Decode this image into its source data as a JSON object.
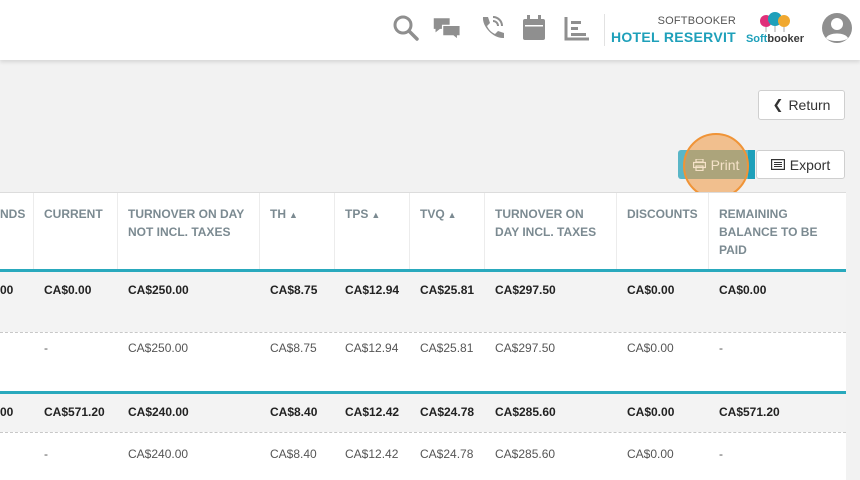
{
  "header": {
    "brand_small": "SOFTBOOKER",
    "brand_big": "HOTEL RESERVIT",
    "logo_text_a": "Soft",
    "logo_text_b": "booker",
    "icons": [
      "search-icon",
      "chat-icon",
      "phone-icon",
      "calendar-icon",
      "bar-chart-icon",
      "user-avatar-icon"
    ]
  },
  "actions": {
    "return_label": "Return",
    "print_label": "Print",
    "export_label": "Export"
  },
  "colors": {
    "accent": "#1ea0ba",
    "print_button": "#5ab6c7",
    "highlight": "#f09437",
    "header_text": "#7b8a91"
  },
  "table": {
    "headers": [
      {
        "line1": "NDS",
        "line2": "",
        "line3": ""
      },
      {
        "line1": "CURRENT",
        "line2": "",
        "line3": ""
      },
      {
        "line1": "TURNOVER ON DAY",
        "line2": "NOT INCL. TAXES",
        "line3": ""
      },
      {
        "line1": "TH",
        "line2": "",
        "line3": ""
      },
      {
        "line1": "TPS",
        "line2": "",
        "line3": ""
      },
      {
        "line1": "TVQ",
        "line2": "",
        "line3": ""
      },
      {
        "line1": "TURNOVER ON",
        "line2": "DAY INCL. TAXES",
        "line3": ""
      },
      {
        "line1": "DISCOUNTS",
        "line2": "",
        "line3": ""
      },
      {
        "line1": "REMAINING",
        "line2": "BALANCE TO BE",
        "line3": "PAID"
      }
    ],
    "rows": [
      [
        "00",
        "CA$0.00",
        "CA$250.00",
        "CA$8.75",
        "CA$12.94",
        "CA$25.81",
        "CA$297.50",
        "CA$0.00",
        "CA$0.00"
      ],
      [
        "",
        "-",
        "CA$250.00",
        "CA$8.75",
        "CA$12.94",
        "CA$25.81",
        "CA$297.50",
        "CA$0.00",
        "-"
      ],
      [
        "00",
        "CA$571.20",
        "CA$240.00",
        "CA$8.40",
        "CA$12.42",
        "CA$24.78",
        "CA$285.60",
        "CA$0.00",
        "CA$571.20"
      ],
      [
        "",
        "-",
        "CA$240.00",
        "CA$8.40",
        "CA$12.42",
        "CA$24.78",
        "CA$285.60",
        "CA$0.00",
        "-"
      ]
    ]
  }
}
